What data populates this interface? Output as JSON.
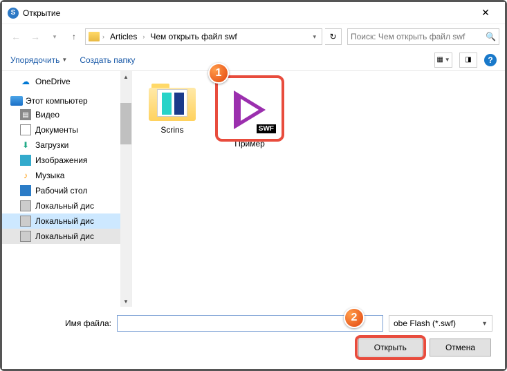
{
  "titlebar": {
    "title": "Открытие"
  },
  "nav": {
    "crumbs": [
      "Articles",
      "Чем открыть файл swf"
    ],
    "search_placeholder": "Поиск: Чем открыть файл swf"
  },
  "toolbar": {
    "organize": "Упорядочить",
    "new_folder": "Создать папку"
  },
  "sidebar": {
    "onedrive": "OneDrive",
    "this_pc": "Этот компьютер",
    "items": [
      {
        "label": "Видео"
      },
      {
        "label": "Документы"
      },
      {
        "label": "Загрузки"
      },
      {
        "label": "Изображения"
      },
      {
        "label": "Музыка"
      },
      {
        "label": "Рабочий стол"
      },
      {
        "label": "Локальный дис"
      },
      {
        "label": "Локальный дис"
      },
      {
        "label": "Локальный дис"
      }
    ]
  },
  "files": {
    "folder_name": "Scrins",
    "swf_name": "Пример",
    "swf_badge": "SWF"
  },
  "footer": {
    "filename_label": "Имя файла:",
    "filename_value": "",
    "filetype": "obe Flash (*.swf)",
    "open": "Открыть",
    "cancel": "Отмена"
  },
  "callouts": {
    "c1": "1",
    "c2": "2"
  }
}
